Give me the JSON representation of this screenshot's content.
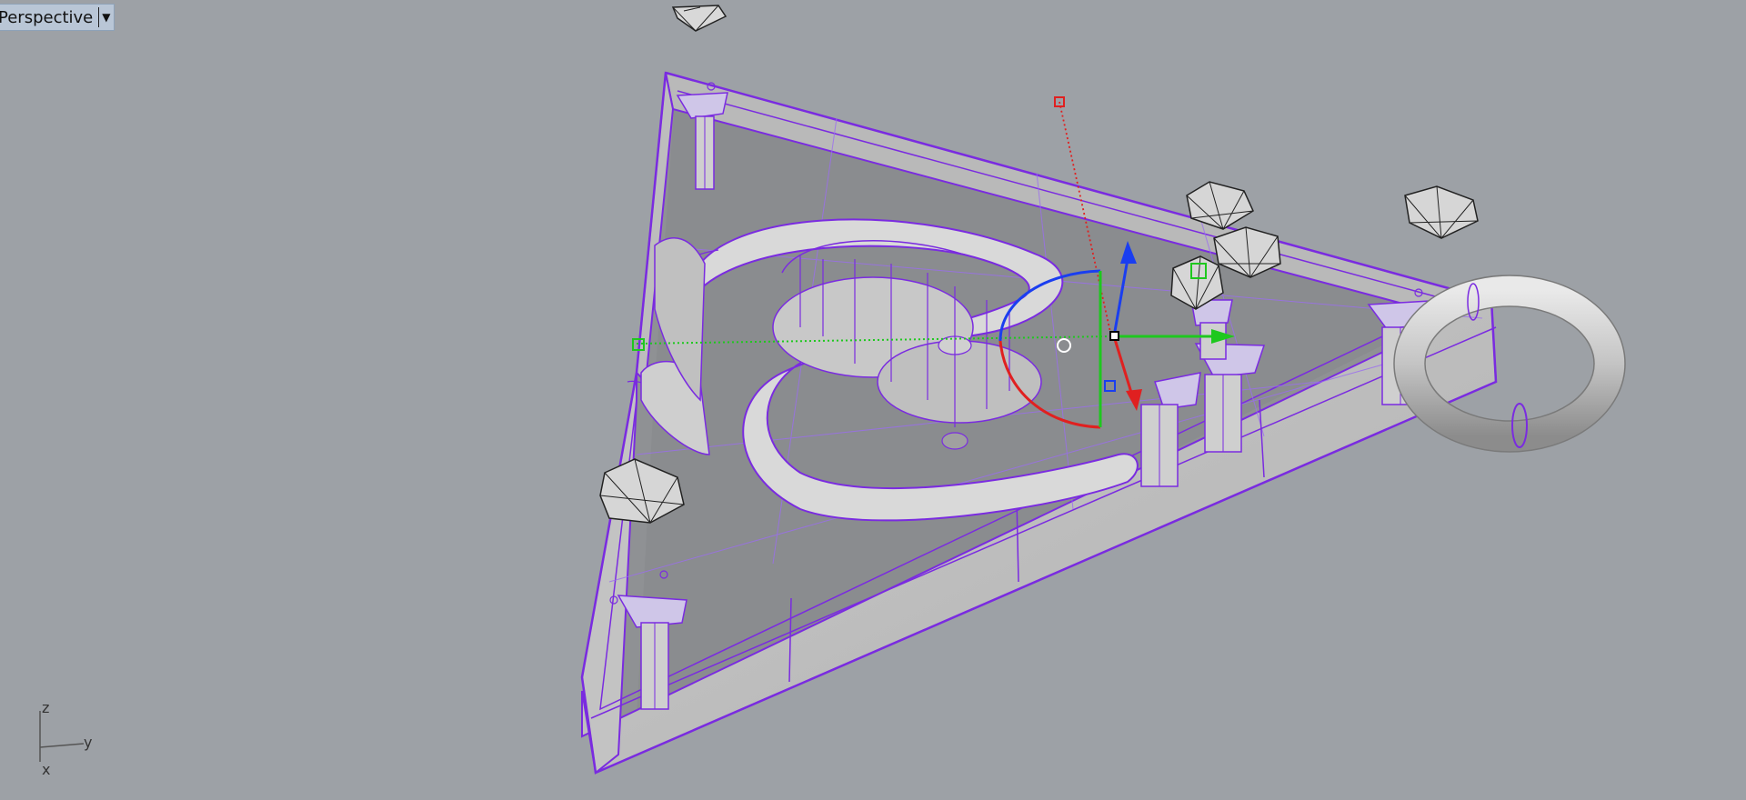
{
  "viewport": {
    "title": "Perspective",
    "dropdown_icon": "caret-down",
    "display_mode": "ghosted",
    "background": "#9da1a6",
    "selection_color": "#7a2be0"
  },
  "axes": {
    "z_label": "z",
    "y_label": "y",
    "x_label": "x"
  },
  "gumball": {
    "x_color": "#e02020",
    "y_color": "#1ec81e",
    "z_color": "#1a3ef0"
  }
}
